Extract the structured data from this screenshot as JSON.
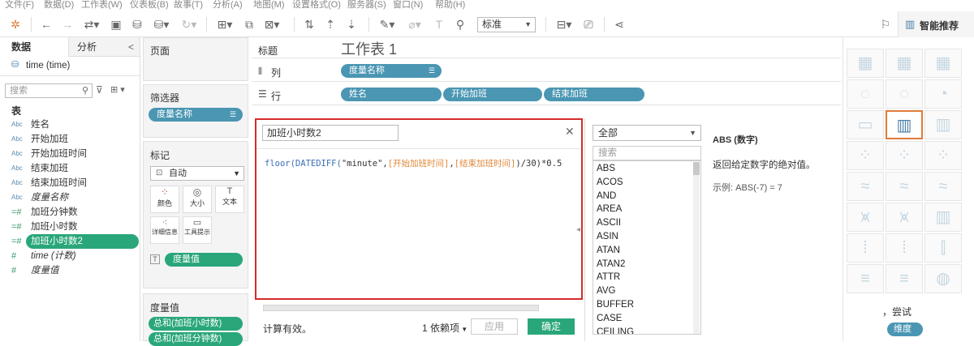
{
  "menu": [
    "文件(F)",
    "数据(D)",
    "工作表(W)",
    "仪表板(B)",
    "故事(T)",
    "分析(A)",
    "地图(M)",
    "设置格式(O)",
    "服务器(S)",
    "窗口(N)",
    "帮助(H)"
  ],
  "toolbar": {
    "fit_select": "标准",
    "smart_recommend": "智能推荐"
  },
  "left": {
    "tab_data": "数据",
    "tab_analysis": "分析",
    "collapse": "<",
    "datasource": "time (time)",
    "search_placeholder": "搜索",
    "section_table": "表",
    "fields": [
      {
        "type": "Abc",
        "name": "姓名",
        "italic": false
      },
      {
        "type": "Abc",
        "name": "开始加班",
        "italic": false
      },
      {
        "type": "Abc",
        "name": "开始加班时间",
        "italic": false
      },
      {
        "type": "Abc",
        "name": "结束加班",
        "italic": false
      },
      {
        "type": "Abc",
        "name": "结束加班时间",
        "italic": false
      },
      {
        "type": "Abc",
        "name": "度量名称",
        "italic": true
      },
      {
        "type": "=#",
        "name": "加班分钟数",
        "italic": false
      },
      {
        "type": "=#",
        "name": "加班小时数",
        "italic": false
      },
      {
        "type": "=#",
        "name": "加班小时数2",
        "italic": false,
        "selected": true
      },
      {
        "type": "#",
        "name": "time (计数)",
        "italic": true
      },
      {
        "type": "#",
        "name": "度量值",
        "italic": true
      }
    ]
  },
  "shelves": {
    "pages": "页面",
    "filters": "筛选器",
    "filter_pill": "度量名称",
    "marks": "标记",
    "marks_type": "自动",
    "mark_buttons": [
      "颜色",
      "大小",
      "文本",
      "详细信息",
      "工具提示"
    ],
    "marks_pill": "度量值",
    "measure_values": "度量值",
    "mv_pills": [
      "总和(加班小时数)",
      "总和(加班分钟数)"
    ],
    "title_label": "标题",
    "sheet_title": "工作表 1",
    "columns_label": "列",
    "columns_pill": "度量名称",
    "rows_label": "行",
    "rows_pills": [
      "姓名",
      "开始加班",
      "结束加班"
    ]
  },
  "calc": {
    "name": "加班小时数2",
    "formula": {
      "fn": "floor(DATEDIFF(",
      "str": "\"minute\"",
      "c1": ",",
      "f1": "[开始加班时间]",
      "c2": ",",
      "f2": "[结束加班时间]",
      "end": ")/30)*0.5"
    },
    "status": "计算有效。",
    "deps": "1 依赖项",
    "apply": "应用",
    "ok": "确定"
  },
  "functions": {
    "category": "全部",
    "search_placeholder": "搜索",
    "list": [
      "ABS",
      "ACOS",
      "AND",
      "AREA",
      "ASCII",
      "ASIN",
      "ATAN",
      "ATAN2",
      "ATTR",
      "AVG",
      "BUFFER",
      "CASE",
      "CEILING"
    ],
    "help_title": "ABS (数字)",
    "help_desc": "返回给定数字的绝对值。",
    "help_example": "示例: ABS(-7) = 7"
  },
  "right": {
    "try_text": "，尝试",
    "dim_pill": "维度"
  }
}
